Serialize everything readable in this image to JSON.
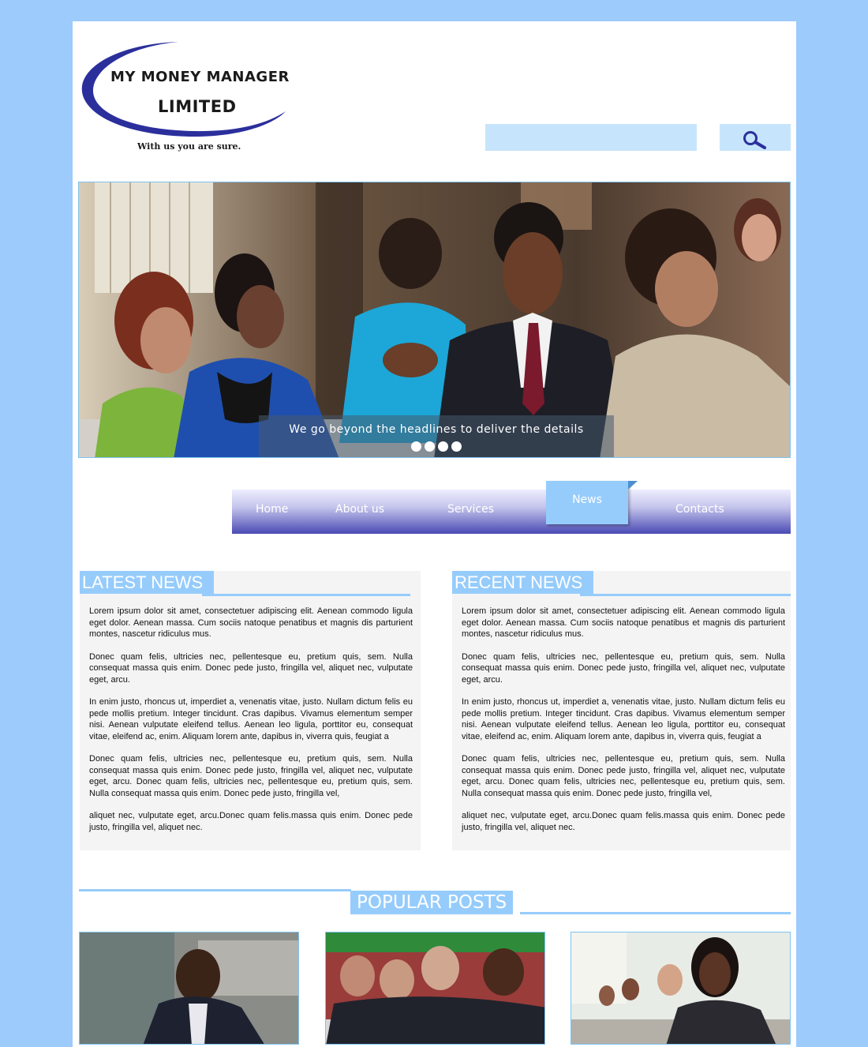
{
  "brand": {
    "line1": "MY MONEY MANAGER",
    "line2": "LIMITED",
    "tagline": "With us you are sure."
  },
  "search": {
    "placeholder": "",
    "value": ""
  },
  "hero": {
    "caption": "We go beyond the headlines to deliver the details",
    "slide_count": 4
  },
  "nav": {
    "items": [
      {
        "label": "Home",
        "active": false
      },
      {
        "label": "About us",
        "active": false
      },
      {
        "label": "Services",
        "active": false
      },
      {
        "label": "News",
        "active": true
      },
      {
        "label": "Contacts",
        "active": false
      }
    ]
  },
  "latest_news": {
    "title": "LATEST NEWS",
    "paragraphs": [
      "Lorem ipsum dolor sit amet, consectetuer adipiscing elit. Aenean commodo ligula eget dolor. Aenean massa. Cum sociis natoque penatibus et magnis dis parturient montes, nascetur ridiculus mus.",
      "Donec quam felis, ultricies nec, pellentesque eu, pretium quis, sem. Nulla consequat massa quis enim. Donec pede justo, fringilla vel, aliquet nec, vulputate eget, arcu.",
      "In enim justo, rhoncus ut, imperdiet a, venenatis vitae, justo. Nullam dictum felis eu pede mollis pretium. Integer tincidunt. Cras dapibus. Vivamus elementum semper nisi. Aenean vulputate eleifend tellus. Aenean leo ligula, porttitor eu, consequat vitae, eleifend ac, enim. Aliquam lorem ante, dapibus in, viverra quis, feugiat a",
      "Donec quam felis, ultricies nec, pellentesque eu, pretium quis, sem. Nulla consequat massa quis enim. Donec pede justo, fringilla vel, aliquet nec, vulputate eget, arcu. Donec quam felis, ultricies nec, pellentesque eu, pretium quis, sem. Nulla consequat massa quis enim. Donec pede justo, fringilla vel,",
      "aliquet nec, vulputate eget, arcu.Donec quam felis.massa quis enim. Donec pede justo, fringilla vel, aliquet nec."
    ]
  },
  "recent_news": {
    "title": "RECENT NEWS",
    "paragraphs": [
      "Lorem ipsum dolor sit amet, consectetuer adipiscing elit. Aenean commodo ligula eget dolor. Aenean massa. Cum sociis natoque penatibus et magnis dis parturient montes, nascetur ridiculus mus.",
      "Donec quam felis, ultricies nec, pellentesque eu, pretium quis, sem. Nulla consequat massa quis enim. Donec pede justo, fringilla vel, aliquet nec, vulputate eget, arcu.",
      "In enim justo, rhoncus ut, imperdiet a, venenatis vitae, justo. Nullam dictum felis eu pede mollis pretium. Integer tincidunt. Cras dapibus. Vivamus elementum semper nisi. Aenean vulputate eleifend tellus. Aenean leo ligula, porttitor eu, consequat vitae, eleifend ac, enim. Aliquam lorem ante, dapibus in, viverra quis, feugiat a",
      "Donec quam felis, ultricies nec, pellentesque eu, pretium quis, sem. Nulla consequat massa quis enim. Donec pede justo, fringilla vel, aliquet nec, vulputate eget, arcu. Donec quam felis, ultricies nec, pellentesque eu, pretium quis, sem. Nulla consequat massa quis enim. Donec pede justo, fringilla vel,",
      "aliquet nec, vulputate eget, arcu.Donec quam felis.massa quis enim. Donec pede justo, fringilla vel, aliquet nec."
    ]
  },
  "popular_posts": {
    "title": "POPULAR POSTS",
    "posts": [
      {
        "image": "man-in-office-photo"
      },
      {
        "image": "panel-discussion-photo"
      },
      {
        "image": "business-meeting-photo"
      }
    ]
  },
  "colors": {
    "page_bg": "#9ccbfc",
    "accent": "#96ccfc",
    "logo_swoosh": "#2b2f9c",
    "nav_dark": "#4a4ab4",
    "search_bg": "#c6e5fc"
  }
}
